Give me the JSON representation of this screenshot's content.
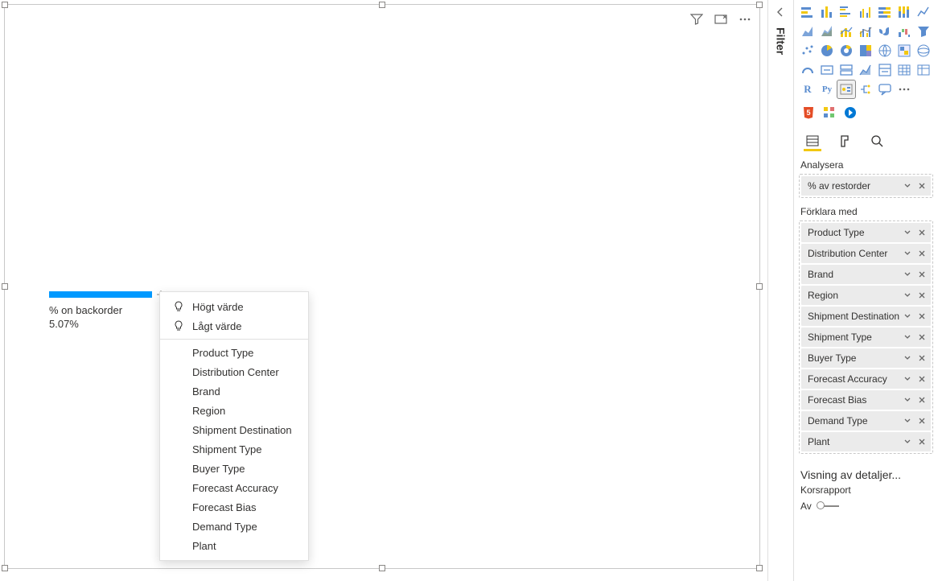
{
  "filterPanel": {
    "label": "Filter"
  },
  "visual": {
    "headerIcons": {
      "filter": "filter-icon",
      "focus": "focus-mode-icon",
      "more": "more-options-icon"
    },
    "ki": {
      "label": "% on backorder",
      "value": "5.07%"
    }
  },
  "contextMenu": {
    "high": "Högt värde",
    "low": "Lågt värde",
    "fields": [
      "Product Type",
      "Distribution Center",
      "Brand",
      "Region",
      "Shipment Destination",
      "Shipment Type",
      "Buyer Type",
      "Forecast Accuracy",
      "Forecast Bias",
      "Demand Type",
      "Plant"
    ]
  },
  "pane": {
    "analyzeLabel": "Analysera",
    "analyzeField": "% av restorder",
    "explainLabel": "Förklara med",
    "explainFields": [
      "Product Type",
      "Distribution Center",
      "Brand",
      "Region",
      "Shipment Destination",
      "Shipment Type",
      "Buyer Type",
      "Forecast Accuracy",
      "Forecast Bias",
      "Demand Type",
      "Plant"
    ],
    "drillTitle": "Visning av detaljer...",
    "crossReport": "Korsrapport",
    "off": "Av"
  },
  "vizTypes": [
    "stacked-bar",
    "stacked-column",
    "clustered-bar",
    "clustered-column",
    "100-stacked-bar",
    "100-stacked-column",
    "line",
    "area",
    "stacked-area",
    "line-stacked-column",
    "line-clustered-column",
    "ribbon",
    "waterfall",
    "scatter",
    "pie",
    "donut",
    "treemap",
    "map",
    "filled-map",
    "funnel",
    "gauge",
    "card",
    "multi-row-card",
    "kpi",
    "slicer",
    "table",
    "matrix",
    "r-visual",
    "python-visual",
    "key-influencers",
    "decomposition-tree",
    "qa",
    "paginated",
    "app",
    "more"
  ],
  "letters": {
    "r": "R",
    "py": "Py"
  }
}
